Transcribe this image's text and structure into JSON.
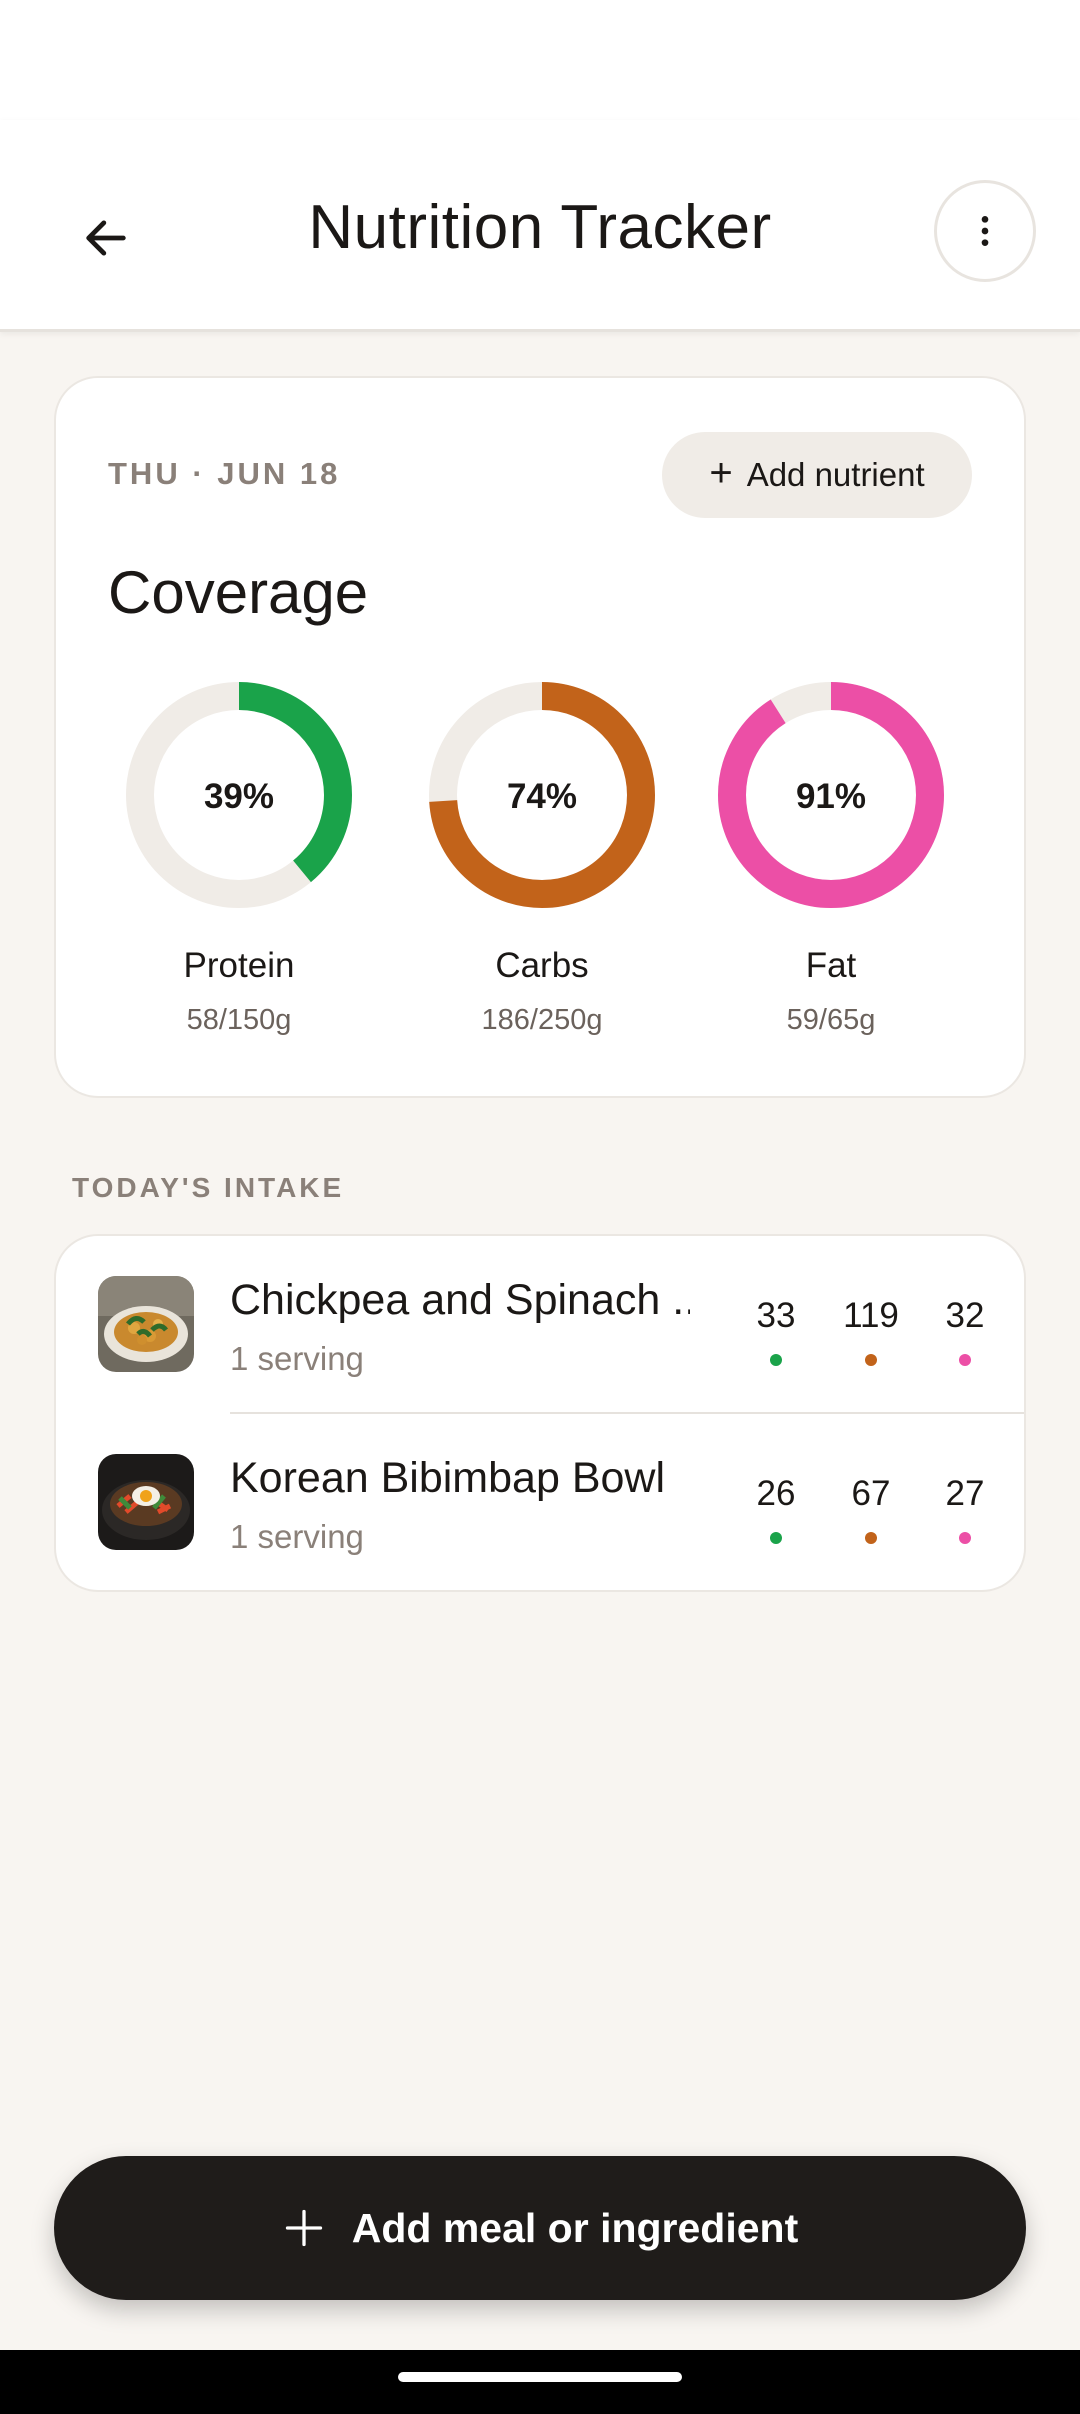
{
  "app": {
    "title": "Nutrition Tracker"
  },
  "coverage": {
    "date": "THU · JUN 18",
    "add_nutrient_label": "Add nutrient",
    "title": "Coverage",
    "nutrients": [
      {
        "name": "Protein",
        "percent_label": "39%",
        "percent": 39,
        "amount": "58/150g",
        "color": "#1aa34a"
      },
      {
        "name": "Carbs",
        "percent_label": "74%",
        "percent": 74,
        "amount": "186/250g",
        "color": "#c2631a"
      },
      {
        "name": "Fat",
        "percent_label": "91%",
        "percent": 91,
        "amount": "59/65g",
        "color": "#ec4fa6"
      }
    ],
    "track_color": "#f0ece7"
  },
  "intake": {
    "section_label": "TODAY'S INTAKE",
    "meals": [
      {
        "name": "Chickpea and Spinach ...",
        "serving": "1 serving",
        "protein": "33",
        "carbs": "119",
        "fat": "32",
        "thumb_icon": "chickpea-dish-photo"
      },
      {
        "name": "Korean Bibimbap Bowl",
        "serving": "1 serving",
        "protein": "26",
        "carbs": "67",
        "fat": "27",
        "thumb_icon": "bibimbap-bowl-photo"
      }
    ]
  },
  "cta": {
    "label": "Add meal or ingredient"
  }
}
